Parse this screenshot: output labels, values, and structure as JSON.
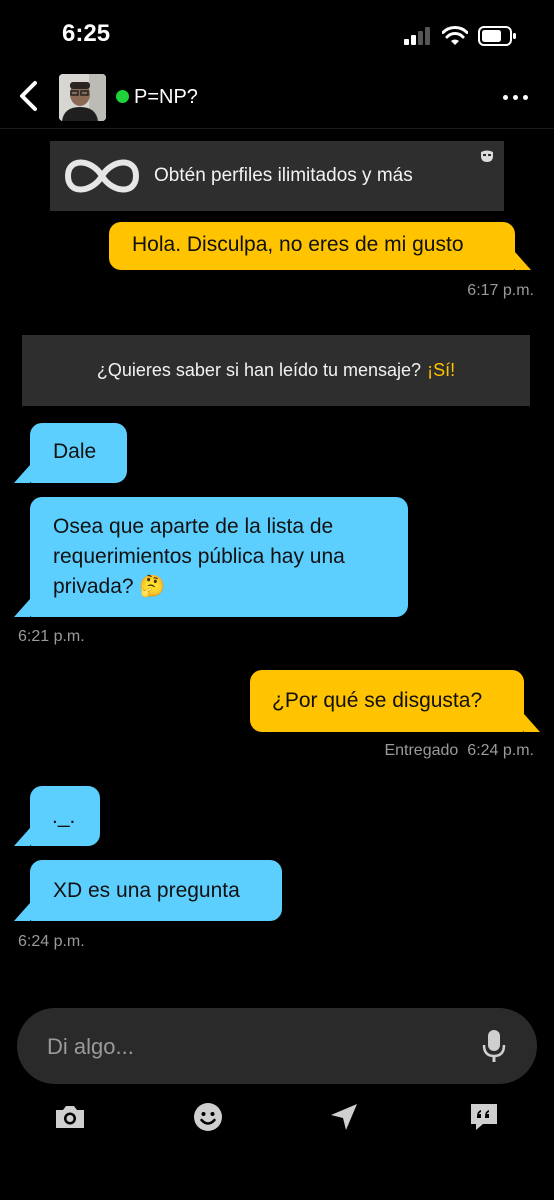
{
  "status_bar": {
    "time": "6:25"
  },
  "header": {
    "contact_name": "P=NP?"
  },
  "promo": {
    "text": "Obtén perfiles ilimitados y más"
  },
  "messages": [
    {
      "direction": "out",
      "text": "Hola. Disculpa, no eres de mi gusto",
      "time": "6:17 p.m."
    },
    {
      "direction": "in",
      "text": "Dale"
    },
    {
      "direction": "in",
      "text": "Osea que aparte de la lista de requerimientos pública hay una privada? 🤔",
      "time": "6:21 p.m."
    },
    {
      "direction": "out",
      "text": "¿Por qué se disgusta?",
      "status": "Entregado",
      "time": "6:24 p.m."
    },
    {
      "direction": "in",
      "text": "._."
    },
    {
      "direction": "in",
      "text": "XD es una pregunta",
      "time": "6:24 p.m."
    }
  ],
  "read_receipt": {
    "question": "¿Quieres saber si han leído tu mensaje?",
    "cta": "¡Sí!"
  },
  "composer": {
    "placeholder": "Di algo..."
  },
  "toolbar": {
    "icons": [
      "camera-icon",
      "emoji-icon",
      "location-icon",
      "quick-replies-icon"
    ]
  },
  "colors": {
    "outgoing": "#ffc300",
    "incoming": "#5ccfff",
    "online": "#1fd23a",
    "background": "#000000"
  }
}
